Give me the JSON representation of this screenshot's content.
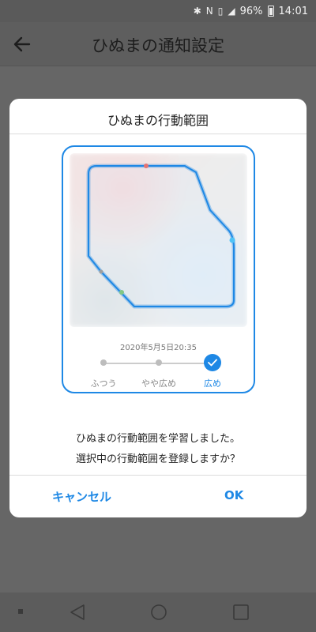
{
  "status_bar": {
    "battery_percent": "96%",
    "time": "14:01"
  },
  "app_bar": {
    "title": "ひぬまの通知設定"
  },
  "dialog": {
    "title": "ひぬまの行動範囲",
    "timestamp": "2020年5月5日20:35",
    "slider": {
      "options": [
        "ふつう",
        "やや広め",
        "広め"
      ],
      "selected_index": 2
    },
    "message_line1": "ひぬまの行動範囲を学習しました。",
    "message_line2": "選択中の行動範囲を登録しますか？",
    "cancel_label": "キャンセル",
    "ok_label": "OK"
  },
  "colors": {
    "accent": "#1e88e5"
  },
  "icons": {
    "back": "arrow-left-icon",
    "check": "check-icon",
    "nav_back": "triangle-back-icon",
    "nav_home": "circle-home-icon",
    "nav_recent": "square-recent-icon"
  }
}
